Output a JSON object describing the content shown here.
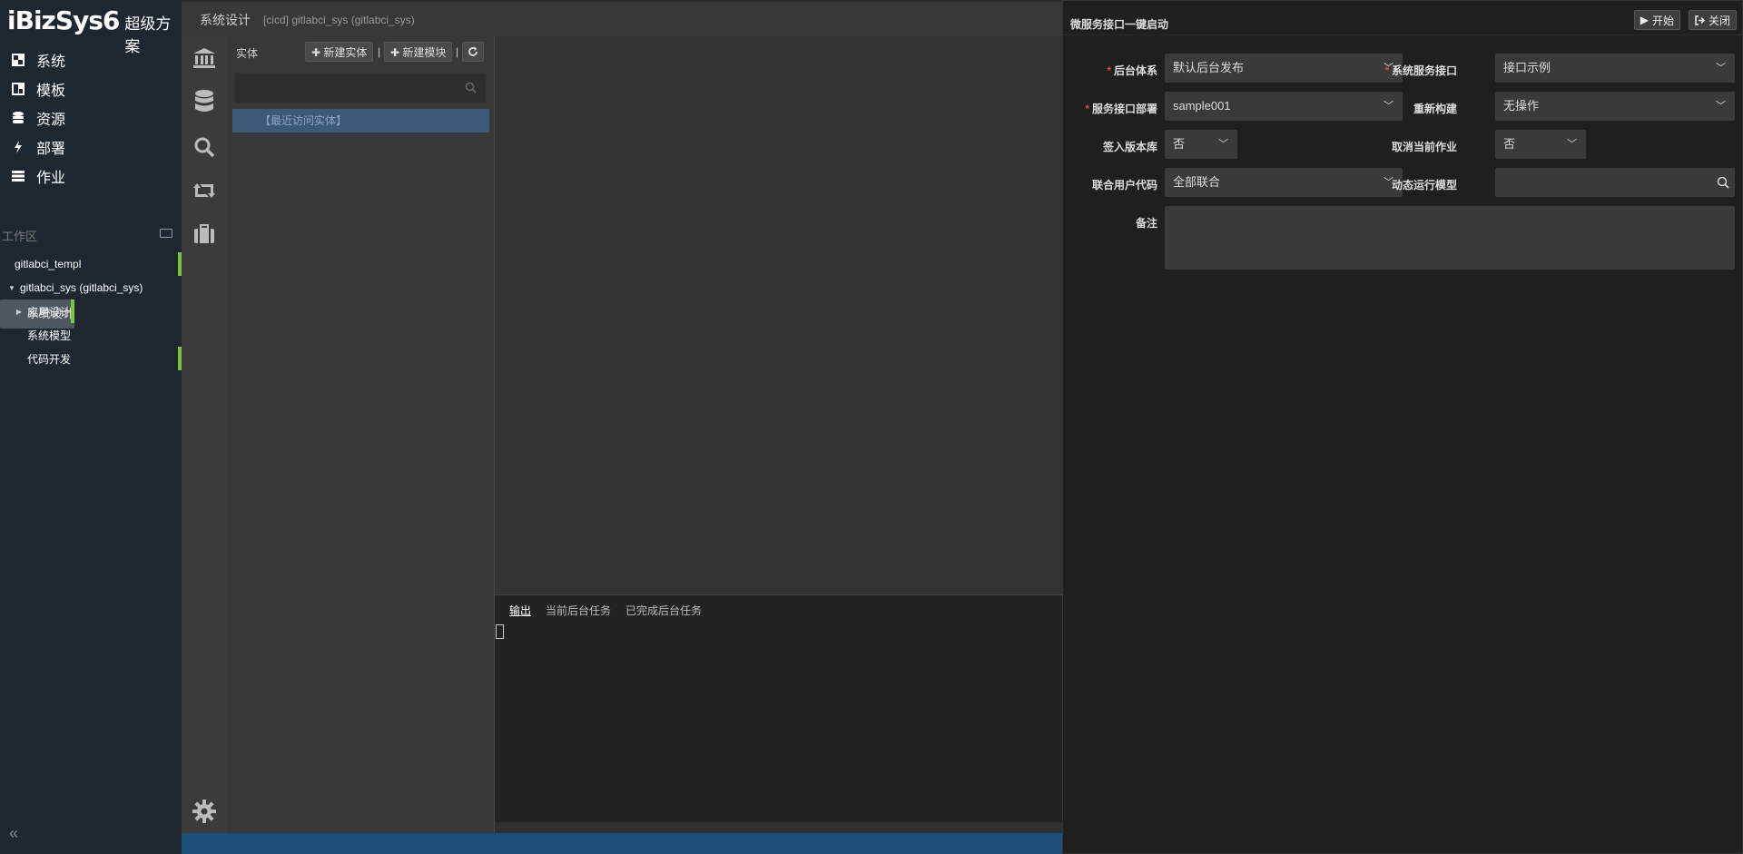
{
  "app": {
    "logo": "iBizSys6",
    "logo_suffix": "超级方案"
  },
  "nav": [
    {
      "label": "系统",
      "icon": "grid-icon"
    },
    {
      "label": "模板",
      "icon": "template-icon"
    },
    {
      "label": "资源",
      "icon": "database-icon"
    },
    {
      "label": "部署",
      "icon": "bolt-icon"
    },
    {
      "label": "作业",
      "icon": "server-icon"
    }
  ],
  "workspace": {
    "header": "工作区",
    "items": [
      {
        "label": "gitlabci_templ",
        "indent": 0,
        "arrow": "",
        "bar": true,
        "selected": false
      },
      {
        "label": "gitlabci_sys (gitlabci_sys)",
        "indent": 0,
        "arrow": "▼",
        "bar": false,
        "selected": false
      },
      {
        "label": "系统设计",
        "indent": 1,
        "arrow": "",
        "bar": true,
        "selected": true
      },
      {
        "label": "应用设计",
        "indent": 1,
        "arrow": "▶",
        "bar": false,
        "selected": false
      },
      {
        "label": "系统模型",
        "indent": 1,
        "arrow": "",
        "bar": false,
        "selected": false
      },
      {
        "label": "代码开发",
        "indent": 1,
        "arrow": "",
        "bar": true,
        "selected": false
      }
    ]
  },
  "topbar": {
    "title": "系统设计",
    "subtitle": "[cicd] gitlabci_sys (gitlabci_sys)"
  },
  "entity_panel": {
    "label": "实体",
    "new_entity": "✚ 新建实体",
    "new_module": "✚ 新建模块",
    "sep": "|",
    "recent": "【最近访问实体】"
  },
  "output": {
    "tabs": [
      "输出",
      "当前后台任务",
      "已完成后台任务"
    ]
  },
  "dialog": {
    "title": "微服务接口一键启动",
    "start": "开始",
    "close": "关闭",
    "fields": {
      "backend": {
        "label": "后台体系",
        "value": "默认后台发布",
        "required": true
      },
      "sys_interface": {
        "label": "系统服务接口",
        "value": "接口示例",
        "required": true
      },
      "deploy": {
        "label": "服务接口部署",
        "value": "sample001",
        "required": true
      },
      "rebuild": {
        "label": "重新构建",
        "value": "无操作",
        "required": false
      },
      "checkin": {
        "label": "签入版本库",
        "value": "否",
        "required": false
      },
      "cancel_job": {
        "label": "取消当前作业",
        "value": "否",
        "required": false
      },
      "user_code": {
        "label": "联合用户代码",
        "value": "全部联合",
        "required": false
      },
      "dyn_model": {
        "label": "动态运行模型",
        "value": "",
        "required": false
      },
      "remark": {
        "label": "备注",
        "value": "",
        "required": false
      }
    }
  }
}
